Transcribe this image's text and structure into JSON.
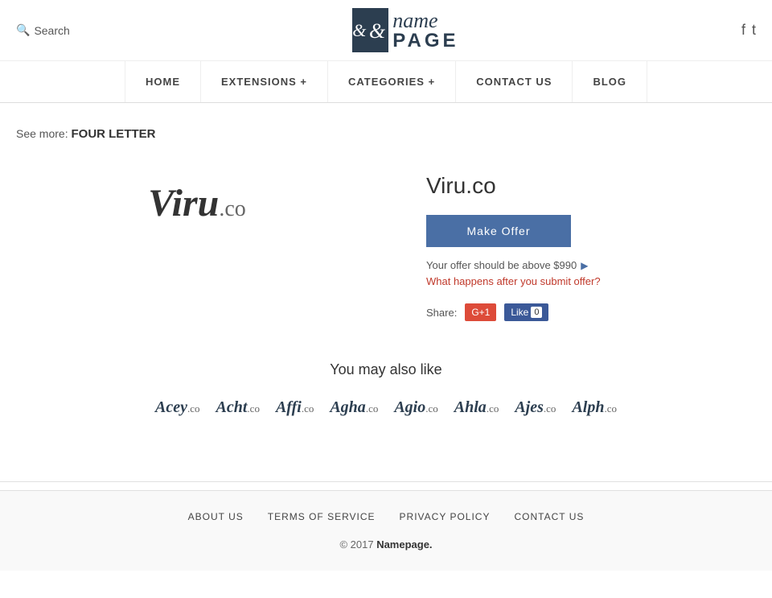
{
  "header": {
    "search_label": "Search",
    "logo_name": "name",
    "logo_page": "PAGE",
    "social": {
      "facebook_icon": "f",
      "twitter_icon": "t"
    }
  },
  "nav": {
    "items": [
      {
        "label": "HOME",
        "url": "#"
      },
      {
        "label": "EXTENSIONS +",
        "url": "#"
      },
      {
        "label": "CATEGORIES +",
        "url": "#"
      },
      {
        "label": "CONTACT US",
        "url": "#"
      },
      {
        "label": "BLOG",
        "url": "#"
      }
    ]
  },
  "breadcrumb": {
    "see_more_label": "See more:",
    "link_label": "FOUR LETTER"
  },
  "domain": {
    "name": "Viru",
    "ext": ".co",
    "full_name": "Viru.co",
    "make_offer_label": "Make Offer",
    "offer_info": "Your offer should be above $990",
    "what_happens_label": "What happens after you submit offer?",
    "share_label": "Share:",
    "gplus_label": "G+1",
    "fb_like_label": "Like",
    "fb_count": "0"
  },
  "also_like": {
    "title": "You may also like",
    "domains": [
      {
        "name": "Acey",
        "ext": ".co"
      },
      {
        "name": "Acht",
        "ext": ".co"
      },
      {
        "name": "Affi",
        "ext": ".co"
      },
      {
        "name": "Agha",
        "ext": ".co"
      },
      {
        "name": "Agio",
        "ext": ".co"
      },
      {
        "name": "Ahla",
        "ext": ".co"
      },
      {
        "name": "Ajes",
        "ext": ".co"
      },
      {
        "name": "Alph",
        "ext": ".co"
      }
    ]
  },
  "footer": {
    "links": [
      {
        "label": "ABOUT US",
        "url": "#"
      },
      {
        "label": "TERMS OF SERVICE",
        "url": "#"
      },
      {
        "label": "PRIVACY POLICY",
        "url": "#"
      },
      {
        "label": "CONTACT US",
        "url": "#"
      }
    ],
    "copyright": "© 2017",
    "site_name": "Namepage.",
    "site_url": "#"
  }
}
